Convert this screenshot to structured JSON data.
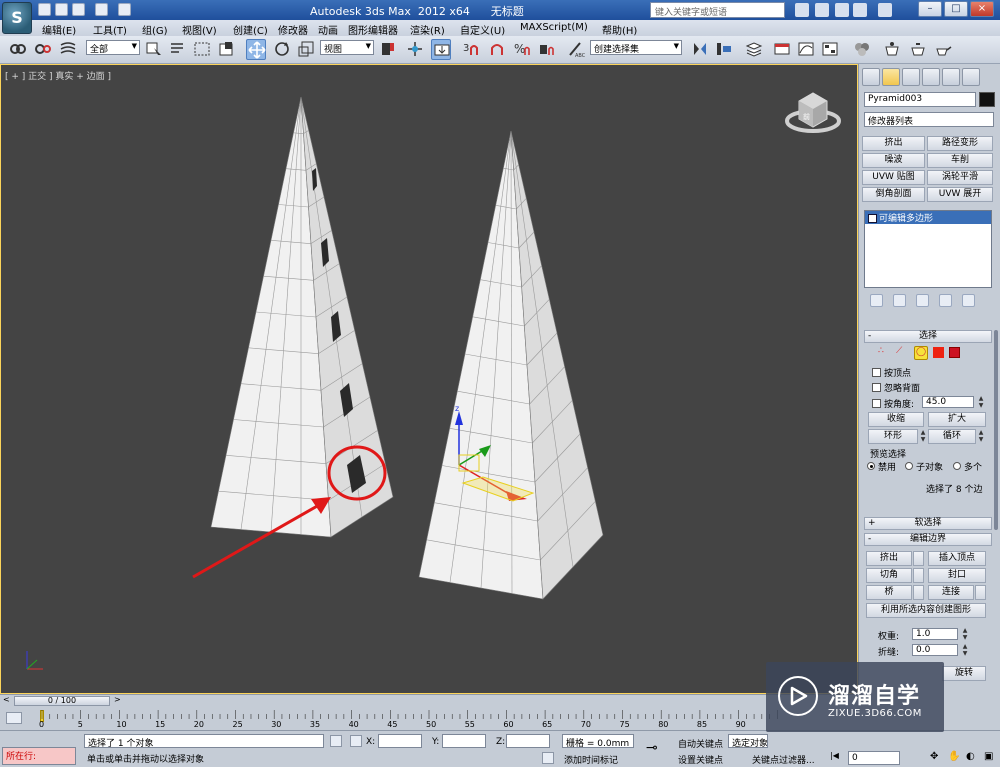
{
  "title_bar": {
    "title": "Autodesk 3ds Max  2012 x64      无标题",
    "search_placeholder": "键入关键字或短语",
    "logo_text": "S"
  },
  "menu": [
    "编辑(E)",
    "工具(T)",
    "组(G)",
    "视图(V)",
    "创建(C)",
    "修改器",
    "动画",
    "图形编辑器",
    "渲染(R)",
    "自定义(U)",
    "MAXScript(M)",
    "帮助(H)"
  ],
  "toolbar": {
    "selection_filter": "全部",
    "reference_coord": "视图",
    "named_selection": "创建选择集",
    "snap_label": "3",
    "percent_label": "%"
  },
  "viewport": {
    "label": "[ + ] 正交 ] 真实 + 边面 ]",
    "viewcube_label": "前"
  },
  "command_panel": {
    "object_name": "Pyramid003",
    "modifier_list": "修改器列表",
    "modifier_buttons": [
      "挤出",
      "路径变形",
      "噪波",
      "车削",
      "UVW 贴图",
      "涡轮平滑",
      "倒角剖面",
      "UVW 展开"
    ],
    "stack_item": "可编辑多边形",
    "selection": {
      "header": "选择",
      "by_vertex": "按顶点",
      "ignore_backfacing": "忽略背面",
      "by_angle": "按角度:",
      "angle_value": "45.0",
      "shrink": "收缩",
      "grow": "扩大",
      "ring": "环形",
      "loop": "循环",
      "preview_label": "预览选择",
      "preview_options": [
        "禁用",
        "子对象",
        "多个"
      ],
      "status": "选择了 8 个边"
    },
    "soft_selection_header": "软选择",
    "edit_borders": {
      "header": "编辑边界",
      "extrude": "挤出",
      "insert_vertex": "插入顶点",
      "chamfer": "切角",
      "cap": "封口",
      "bridge": "桥",
      "connect": "连接",
      "create_shape": "利用所选内容创建图形",
      "weight_label": "权重:",
      "weight_value": "1.0",
      "crease_label": "折缝:",
      "crease_value": "0.0",
      "rotate": "旋转"
    }
  },
  "timeline": {
    "frame_display": "0 / 100",
    "ticks": [
      "0",
      "5",
      "10",
      "15",
      "20",
      "25",
      "30",
      "35",
      "40",
      "45",
      "50",
      "55",
      "60",
      "65",
      "70",
      "75",
      "80",
      "85",
      "90"
    ]
  },
  "status_bar": {
    "maxscript_label": "所在行:",
    "selection_status": "选择了 1 个对象",
    "prompt": "单击或单击并拖动以选择对象",
    "x_label": "X:",
    "y_label": "Y:",
    "z_label": "Z:",
    "grid": "栅格 = 0.0mm",
    "add_time_tag": "添加时间标记",
    "auto_key": "自动关键点",
    "set_key": "设置关键点",
    "selected": "选定对象",
    "key_filters": "关键点过滤器...",
    "frame_value": "0"
  },
  "watermark": {
    "cn": "溜溜自学",
    "en": "ZIXUE.3D66.COM"
  },
  "colors": {
    "title_blue": "#2a5da8",
    "viewport_bg": "#444444",
    "annotation_red": "#e01818",
    "panel_bg": "#c5ccd6"
  }
}
